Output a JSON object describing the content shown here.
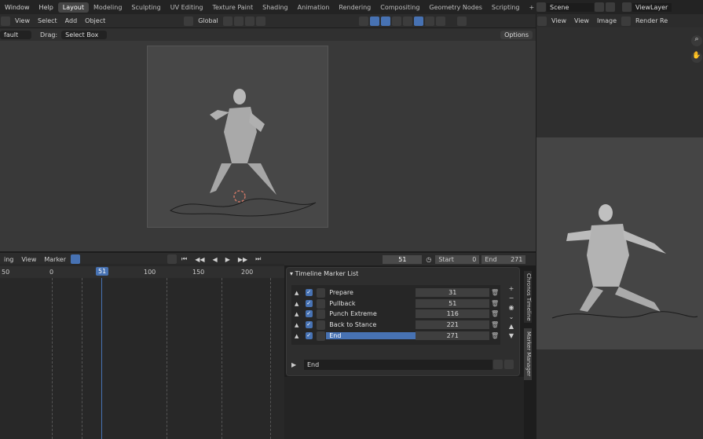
{
  "menu": {
    "window": "Window",
    "help": "Help"
  },
  "workspaces": [
    "Layout",
    "Modeling",
    "Sculpting",
    "UV Editing",
    "Texture Paint",
    "Shading",
    "Animation",
    "Rendering",
    "Compositing",
    "Geometry Nodes",
    "Scripting"
  ],
  "right_top": {
    "scene": "Scene",
    "view_layer": "ViewLayer"
  },
  "viewport_header": {
    "view": "View",
    "select": "Select",
    "add": "Add",
    "object": "Object",
    "orientation": "Global"
  },
  "viewport_sub": {
    "mode": "fault",
    "drag_label": "Drag:",
    "drag_value": "Select Box",
    "options": "Options"
  },
  "timeline_header": {
    "mode": "ing",
    "view": "View",
    "marker": "Marker",
    "current_frame": "51",
    "start_label": "Start",
    "start": "0",
    "end_label": "End",
    "end": "271"
  },
  "ruler": {
    "ticks": [
      "50",
      "0",
      "51",
      "100",
      "150",
      "200"
    ]
  },
  "marker_panel": {
    "title": "Timeline Marker List",
    "markers": [
      {
        "name": "Prepare",
        "frame": "31"
      },
      {
        "name": "Pullback",
        "frame": "51"
      },
      {
        "name": "Punch Extreme",
        "frame": "116"
      },
      {
        "name": "Back to Stance",
        "frame": "221"
      },
      {
        "name": "End",
        "frame": "271"
      }
    ],
    "edit_value": "End"
  },
  "side_tabs": {
    "tab1": "Chronos Timeline",
    "tab2": "Marker Manager"
  },
  "image_editor": {
    "view": "View",
    "view2": "View",
    "image": "Image",
    "render": "Render Re"
  }
}
